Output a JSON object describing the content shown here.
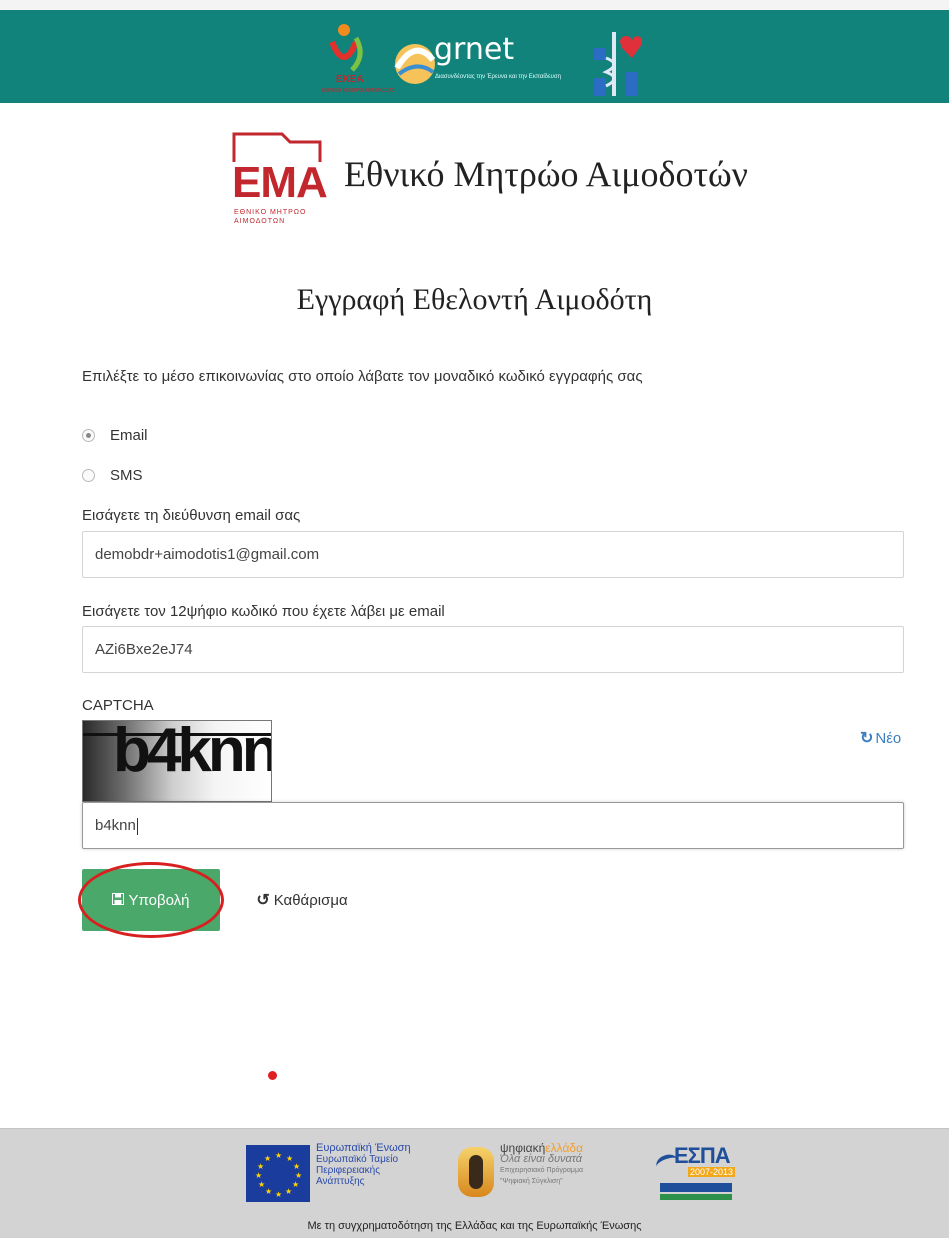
{
  "header": {
    "ekea_logo_text": "ΕΚΕΑ",
    "ekea_logo_subtext": "ΕΘΝΙΚΟ ΚΕΝΤΡΟ ΑΙΜΟΔΟΣΙΑΣ",
    "grnet_logo_text": "grnet",
    "grnet_tagline": "Διασυνδέοντας την Έρευνα και την Εκπαίδευση",
    "ministry_logo": "health-ministry-logo"
  },
  "brand": {
    "logo_text": "ΕΜΑ",
    "logo_subtext": "ΕΘΝΙΚΟ ΜΗΤΡΩΟ ΑΙΜΟΔΟΤΩΝ",
    "site_title": "Εθνικό Μητρώο Αιμοδοτών"
  },
  "page": {
    "title": "Εγγραφή Εθελοντή Αιμοδότη"
  },
  "form": {
    "intro": "Επιλέξτε το μέσο επικοινωνίας στο οποίο λάβατε τον μοναδικό κωδικό εγγραφής σας",
    "channel_options": [
      "Email",
      "SMS"
    ],
    "channel_selected": "Email",
    "email_label": "Εισάγετε τη διεύθυνση email σας",
    "email_value": "demobdr+aimodotis1@gmail.com",
    "code_label": "Εισάγετε τον 12ψήφιο κωδικό που έχετε λάβει με email",
    "code_value": "AZi6Bxe2eJ74",
    "captcha_label": "CAPTCHA",
    "captcha_image_text": "b4knn",
    "captcha_refresh": "Νέο",
    "captcha_value": "b4knn",
    "submit_label": "Υποβολή",
    "clear_label": "Καθάρισμα"
  },
  "icons": {
    "refresh": "refresh-icon",
    "save": "save-icon",
    "undo": "undo-icon"
  },
  "footer": {
    "eu_title": "Ευρωπαϊκή Ένωση",
    "eu_lines": [
      "Ευρωπαϊκό Ταμείο",
      "Περιφερειακής",
      "Ανάπτυξης"
    ],
    "digital_brand_a": "ψηφιακή",
    "digital_brand_b": "ελλάδα",
    "digital_slogan": "Όλα είναι δυνατά",
    "digital_lines": [
      "Επιχειρησιακό Πρόγραμμα",
      "\"Ψηφιακή Σύγκλιση\""
    ],
    "espa_text": "ΕΣΠΑ",
    "espa_years": "2007-2013",
    "caption": "Με τη συγχρηματοδότηση της Ελλάδας και της Ευρωπαϊκής Ένωσης"
  },
  "colors": {
    "header_bg": "#12837b",
    "brand_red": "#c1272d",
    "submit_green": "#4aa86a",
    "link_blue": "#3a7fc1",
    "footer_bg": "#d3d3d3",
    "annotation_red": "#d92020"
  }
}
